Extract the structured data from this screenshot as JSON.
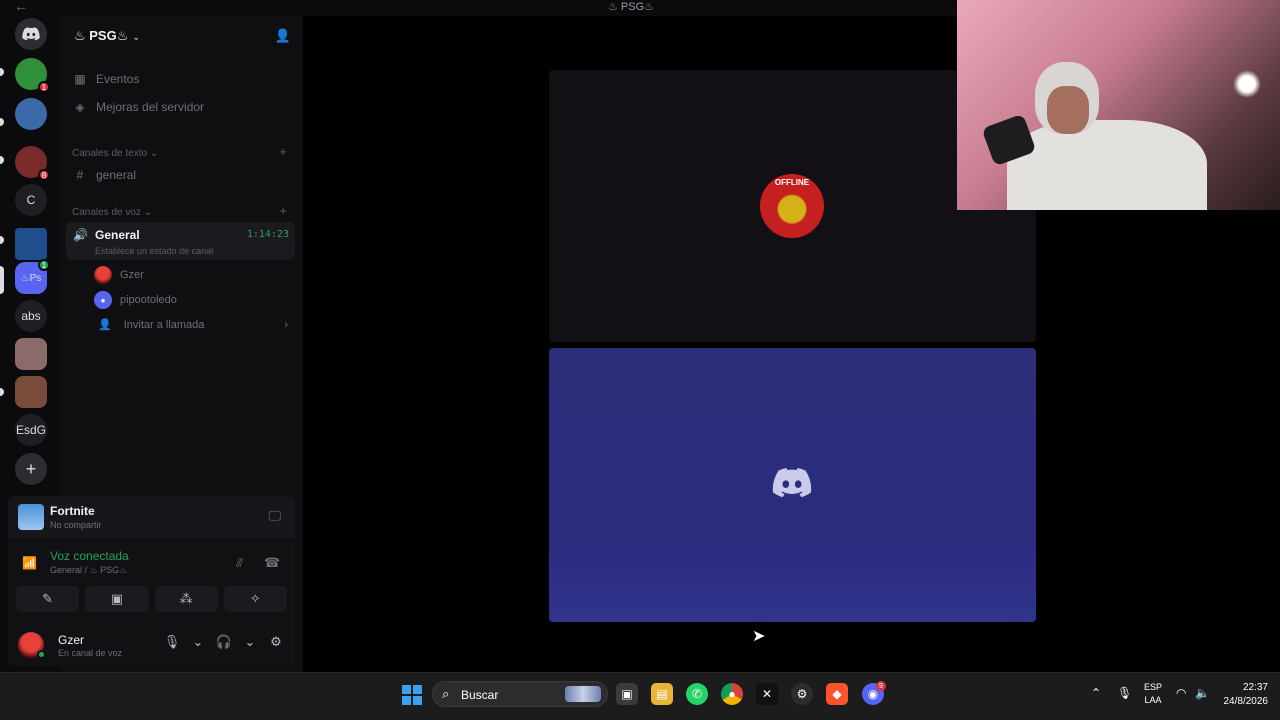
{
  "window": {
    "title": "♨ PSG♨",
    "back": "←"
  },
  "rail": {
    "servers": [
      {
        "label": "",
        "color": "#5865f2",
        "icon": "discord-icon"
      },
      {
        "label": "",
        "color": "#2f8f3a",
        "badge": "1"
      },
      {
        "label": "",
        "color": "#3b6aa8"
      },
      {
        "label": "",
        "color": "#7a2c2c",
        "badge": "8"
      },
      {
        "label": "C",
        "color": "#1e1f22"
      },
      {
        "label": "",
        "color": "#1f4e8c"
      },
      {
        "label": "♨Ps",
        "color": "#5865f2",
        "badge": "1"
      },
      {
        "label": "abs",
        "color": "#1e1f22"
      },
      {
        "label": "",
        "color": "#8a6a6a"
      },
      {
        "label": "",
        "color": "#7a4a3a"
      },
      {
        "label": "EsdG",
        "color": "#1e1f22"
      },
      {
        "label": "+",
        "color": "#2b2d31"
      }
    ]
  },
  "sidebar": {
    "server_name": "♨ PSG♨",
    "links": [
      {
        "label": "Eventos",
        "icon": "calendar-icon"
      },
      {
        "label": "Mejoras del servidor",
        "icon": "boost-icon"
      }
    ],
    "text_category": "Canales de texto",
    "text_channels": [
      {
        "label": "general"
      }
    ],
    "voice_category": "Canales de voz",
    "voice_channel": {
      "name": "General",
      "time": "1:14:23",
      "status": "Establece un estado de canal"
    },
    "voice_users": [
      {
        "name": "Gzer"
      },
      {
        "name": "pipootoledo"
      }
    ],
    "invite": "Invitar a llamada"
  },
  "panel": {
    "game": {
      "name": "Fortnite",
      "sub": "No compartir"
    },
    "voice": {
      "label": "Voz conectada",
      "sub": "General / ♨ PSG♨"
    },
    "user": {
      "name": "Gzer",
      "status": "En canal de voz"
    }
  },
  "stage": {
    "offline_text": "OFFLINE"
  },
  "taskbar": {
    "search": "Buscar",
    "lang_1": "ESP",
    "lang_2": "LAA",
    "time": "22:37",
    "date": "24/8/2026",
    "discord_badge": "9"
  }
}
